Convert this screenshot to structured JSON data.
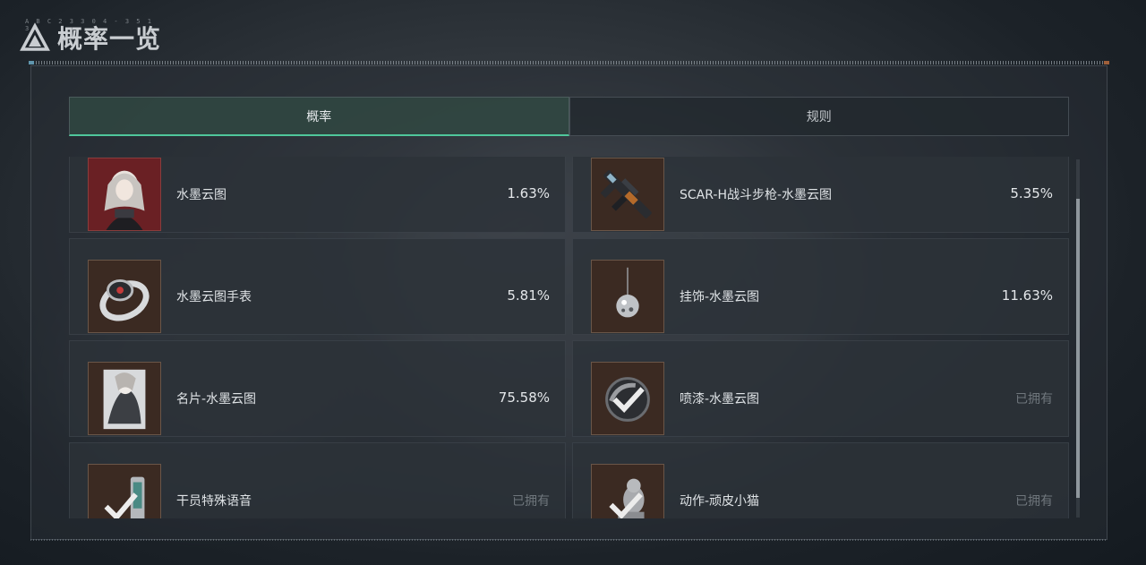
{
  "header": {
    "title": "概率一览",
    "deco_text": "A B C 2 3 3 0 4 - 3 5 1 3"
  },
  "tabs": [
    {
      "label": "概率",
      "active": true
    },
    {
      "label": "规则",
      "active": false
    }
  ],
  "items": [
    {
      "name": "水墨云图",
      "probability": "1.63%",
      "icon": "character-portrait-icon",
      "thumb_color": "red"
    },
    {
      "name": "SCAR-H战斗步枪-水墨云图",
      "probability": "5.35%",
      "icon": "rifle-icon",
      "thumb_color": "brown"
    },
    {
      "name": "水墨云图手表",
      "probability": "5.81%",
      "icon": "watch-icon",
      "thumb_color": "brown"
    },
    {
      "name": "挂饰-水墨云图",
      "probability": "11.63%",
      "icon": "pendant-icon",
      "thumb_color": "brown"
    },
    {
      "name": "名片-水墨云图",
      "probability": "75.58%",
      "icon": "name-card-icon",
      "thumb_color": "brown"
    },
    {
      "name": "喷漆-水墨云图",
      "probability": "已拥有",
      "icon": "spray-checkmark-icon",
      "thumb_color": "brown",
      "owned": true
    },
    {
      "name": "干员特殊语音",
      "probability": "已拥有",
      "icon": "voice-checkmark-icon",
      "thumb_color": "brown",
      "owned": true
    },
    {
      "name": "动作-顽皮小猫",
      "probability": "已拥有",
      "icon": "emote-checkmark-icon",
      "thumb_color": "brown",
      "owned": true
    }
  ],
  "colors": {
    "accent": "#4fc79b",
    "thumb_brown": "#3b2a22",
    "thumb_red": "#6a2024",
    "owned_text": "#6f767c"
  }
}
